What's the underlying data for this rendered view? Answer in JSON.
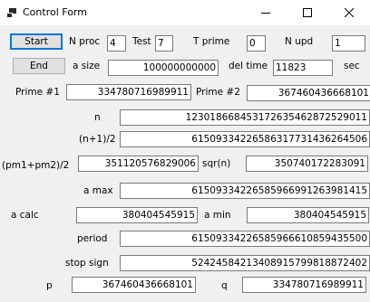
{
  "window": {
    "title": "Control Form"
  },
  "buttons": {
    "start": "Start",
    "end": "End"
  },
  "labels": {
    "n_proc": "N proc",
    "test": "Test",
    "t_prime": "T prime",
    "n_upd": "N upd",
    "a_size": "a size",
    "del_time": "del time",
    "sec": "sec",
    "prime1": "Prime #1",
    "prime2": "Prime #2",
    "n": "n",
    "n1_2": "(n+1)/2",
    "pm_avg": "(pm1+pm2)/2",
    "sqrn": "sqr(n)",
    "a_max": "a max",
    "a_calc": "a calc",
    "a_min": "a min",
    "period": "period",
    "stop_sign": "stop sign",
    "p": "p",
    "q": "q"
  },
  "fields": {
    "n_proc": "4",
    "test": "7",
    "t_prime": "0",
    "n_upd": "1",
    "a_size": "100000000000",
    "del_time": "11823",
    "prime1": "334780716989911",
    "prime2": "367460436668101",
    "n": "123018668453172635462872529011",
    "n1_2": "61509334226586317731436264506",
    "pm_avg": "351120576829006",
    "sqrn": "350740172283091",
    "a_max": "61509334226585966991263981415",
    "a_calc": "380404545915",
    "a_min": "380404545915",
    "period": "61509334226585966610859435500",
    "stop_sign": "52424584213408915799818872402",
    "p": "367460436668101",
    "q": "334780716989911"
  }
}
